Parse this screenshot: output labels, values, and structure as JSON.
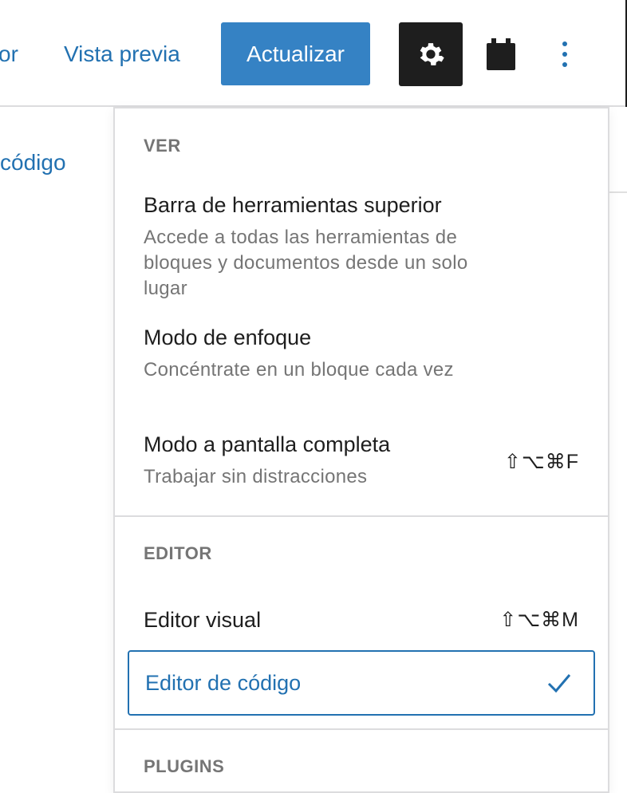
{
  "header": {
    "partial_link": "or",
    "preview_label": "Vista previa",
    "update_label": "Actualizar"
  },
  "background": {
    "partial_text": "código"
  },
  "menu": {
    "ver": {
      "title": "VER",
      "items": [
        {
          "label": "Barra de herramientas superior",
          "description": "Accede a todas las herramientas de bloques y documentos desde un solo lugar"
        },
        {
          "label": "Modo de enfoque",
          "description": "Concéntrate en un bloque cada vez"
        },
        {
          "label": "Modo a pantalla completa",
          "description": "Trabajar sin distracciones",
          "shortcut": "⇧⌥⌘F"
        }
      ]
    },
    "editor": {
      "title": "EDITOR",
      "items": [
        {
          "label": "Editor visual",
          "shortcut": "⇧⌥⌘M"
        },
        {
          "label": "Editor de código",
          "selected": true
        }
      ]
    },
    "plugins": {
      "title": "PLUGINS"
    }
  },
  "colors": {
    "accent": "#2271b1",
    "primary_button": "#3582c4",
    "dark_button": "#1e1e1e",
    "muted_text": "#757575"
  }
}
